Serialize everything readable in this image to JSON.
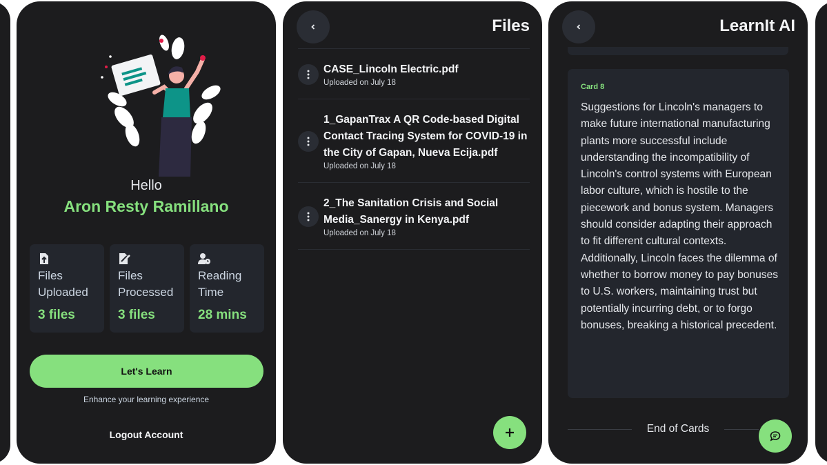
{
  "profile": {
    "greeting": "Hello",
    "user_name": "Aron Resty Ramillano",
    "stats": [
      {
        "icon": "file-upload-icon",
        "label": "Files Uploaded",
        "value": "3 files"
      },
      {
        "icon": "file-edit-icon",
        "label": "Files Processed",
        "value": "3 files"
      },
      {
        "icon": "user-clock-icon",
        "label": "Reading Time",
        "value": "28 mins"
      }
    ],
    "learn_button": "Let's Learn",
    "learn_subtitle": "Enhance your learning experience",
    "logout_label": "Logout Account"
  },
  "files_screen": {
    "title": "Files",
    "back_icon": "chevron-left-icon",
    "files": [
      {
        "name": "CASE_Lincoln Electric.pdf",
        "date": "Uploaded on July 18"
      },
      {
        "name": "1_GapanTrax A QR Code-based Digital Contact Tracing System for COVID-19 in the City of Gapan, Nueva Ecija.pdf",
        "date": "Uploaded on July 18"
      },
      {
        "name": "2_The Sanitation Crisis and Social Media_Sanergy in Kenya.pdf",
        "date": "Uploaded on July 18"
      }
    ],
    "fab_icon": "plus-icon"
  },
  "learn_screen": {
    "title": "LearnIt AI",
    "card_label": "Card 8",
    "card_text": "Suggestions for Lincoln's managers to make future international manufacturing plants more successful include understanding the incompatibility of Lincoln's control systems with European labor culture, which is hostile to the piecework and bonus system. Managers should consider adapting their approach to fit different cultural contexts. Additionally, Lincoln faces the dilemma of whether to borrow money to pay bonuses to U.S. workers, maintaining trust but potentially incurring debt, or to forgo bonuses, breaking a historical precedent.",
    "end_text": "End of Cards",
    "fab_icon": "chat-icon"
  },
  "colors": {
    "accent": "#86e07e",
    "phone_bg": "#1c1c1e",
    "card_bg": "#23262d",
    "button_bg": "#2a2d34"
  }
}
